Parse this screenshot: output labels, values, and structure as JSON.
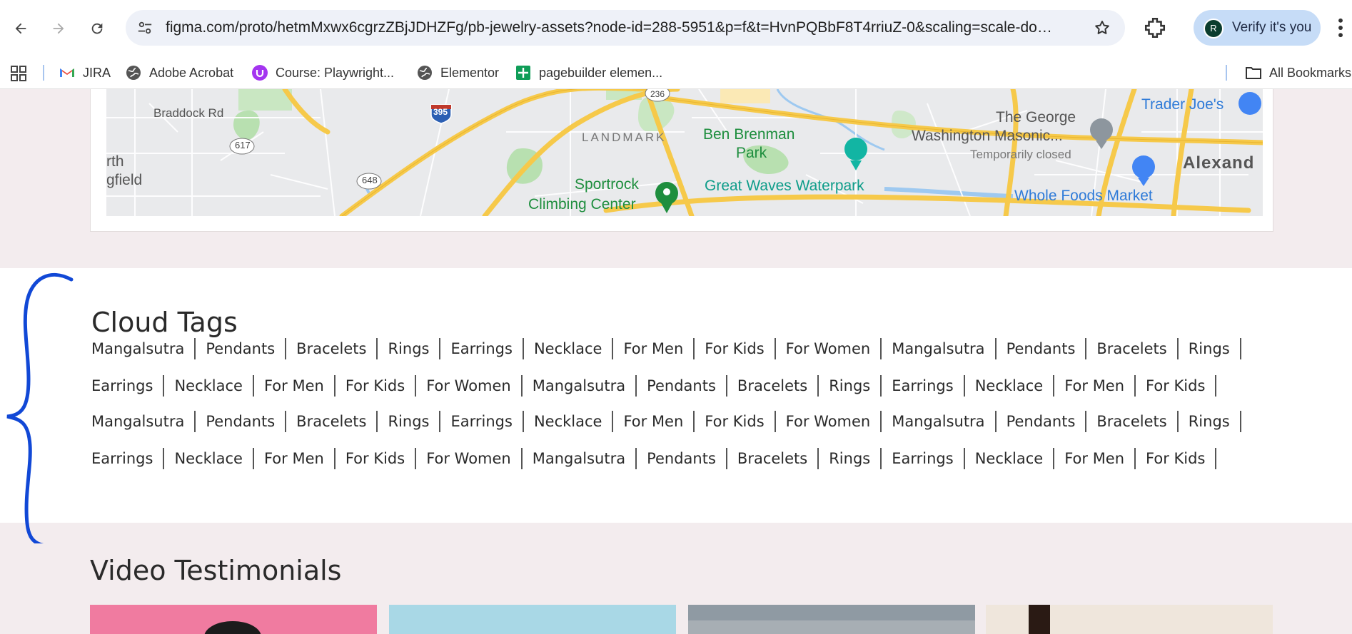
{
  "browser": {
    "url": "figma.com/proto/hetmMxwx6cgrzZBjJDHZFg/pb-jewelry-assets?node-id=288-5951&p=f&t=HvnPQBbF8T4rriuZ-0&scaling=scale-down...",
    "verify_label": "Verify it's you",
    "avatar_letter": "R",
    "bookmarks": [
      "JIRA",
      "Adobe Acrobat",
      "Course: Playwright...",
      "Elementor",
      "pagebuilder elemen..."
    ],
    "all_bookmarks": "All Bookmarks"
  },
  "map": {
    "labels": {
      "braddock": "Braddock Rd",
      "r617": "617",
      "r648": "648",
      "r395": "395",
      "r236": "236",
      "landmark": "LANDMARK",
      "ben1": "Ben Brenman",
      "ben2": "Park",
      "sport1": "Sportrock",
      "sport2": "Climbing Center",
      "great_waves": "Great Waves Waterpark",
      "george1": "The George",
      "george2": "Washington Masonic...",
      "temp_closed": "Temporarily closed",
      "trader": "Trader Joe's",
      "whole": "Whole Foods Market",
      "alex": "Alexand",
      "rth": "rth",
      "gfield": "gfield"
    }
  },
  "cloud_tags": {
    "title": "Cloud Tags",
    "rows": [
      [
        "Mangalsutra",
        "Pendants",
        "Bracelets",
        "Rings",
        "Earrings",
        "Necklace",
        "For Men",
        "For Kids",
        "For Women",
        "Mangalsutra",
        "Pendants",
        "Bracelets",
        "Rings"
      ],
      [
        "Earrings",
        "Necklace",
        "For Men",
        "For Kids",
        "For Women",
        "Mangalsutra",
        "Pendants",
        "Bracelets",
        "Rings",
        "Earrings",
        "Necklace",
        "For Men",
        "For Kids"
      ],
      [
        "Mangalsutra",
        "Pendants",
        "Bracelets",
        "Rings",
        "Earrings",
        "Necklace",
        "For Men",
        "For Kids",
        "For Women",
        "Mangalsutra",
        "Pendants",
        "Bracelets",
        "Rings"
      ],
      [
        "Earrings",
        "Necklace",
        "For Men",
        "For Kids",
        "For Women",
        "Mangalsutra",
        "Pendants",
        "Bracelets",
        "Rings",
        "Earrings",
        "Necklace",
        "For Men",
        "For Kids"
      ]
    ]
  },
  "video_testimonials": {
    "title": "Video Testimonials",
    "thumb_colors": [
      "#f07ba0",
      "#a9d8e6",
      "#8f9aa3",
      "#cdb9a6"
    ]
  },
  "colors": {
    "brace": "#1148d6",
    "page_bg": "#f3ecee",
    "road": "#f6c94a",
    "park": "#c9e7c2"
  }
}
